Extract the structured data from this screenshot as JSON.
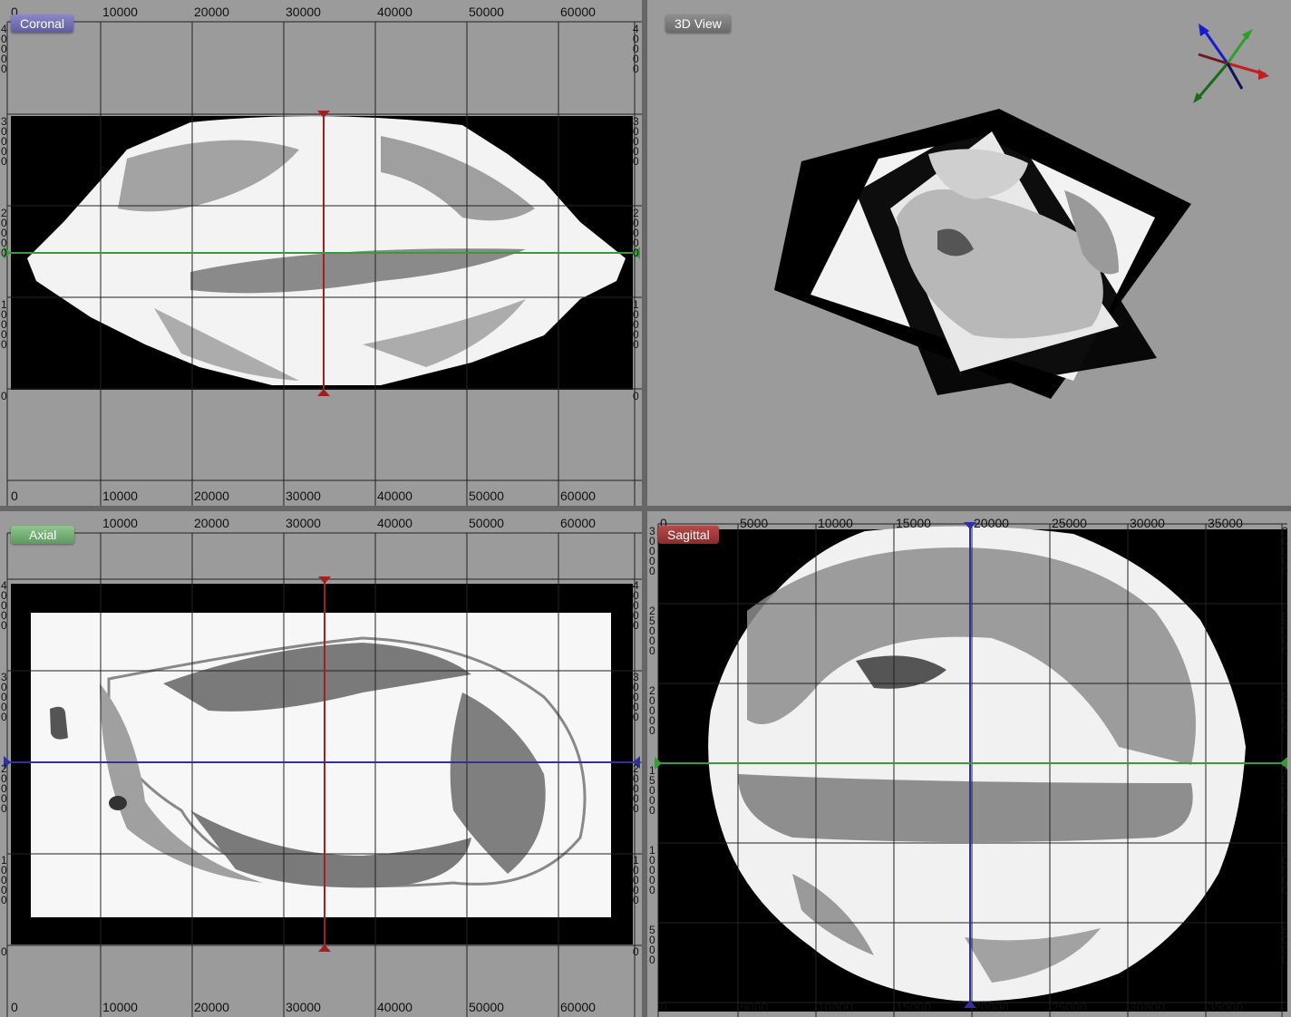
{
  "views": {
    "coronal": {
      "label": "Coronal"
    },
    "view3d": {
      "label": "3D View"
    },
    "axial": {
      "label": "Axial"
    },
    "sagittal": {
      "label": "Sagittal"
    }
  },
  "coronal_axis": {
    "x_ticks": [
      "0",
      "10000",
      "20000",
      "30000",
      "40000",
      "50000",
      "60000"
    ],
    "y_ticks_top_to_bottom": [
      "40000",
      "30000",
      "20000",
      "10000",
      "0"
    ],
    "corner_top_right": "4",
    "corner_bottom": "1"
  },
  "axial_axis": {
    "x_ticks": [
      "0",
      "10000",
      "20000",
      "30000",
      "40000",
      "50000",
      "60000"
    ],
    "y_ticks_top_to_bottom": [
      "40000",
      "30000",
      "20000",
      "10000",
      "0"
    ]
  },
  "sagittal_axis": {
    "x_ticks": [
      "0",
      "5000",
      "10000",
      "15000",
      "20000",
      "25000",
      "30000",
      "35000"
    ],
    "y_ticks_top_to_bottom": [
      "30000",
      "25000",
      "20000",
      "15000",
      "10000",
      "5000",
      "0"
    ]
  },
  "colors": {
    "panel_bg": "#9b9b9b",
    "crosshair_red": "#a02020",
    "crosshair_green": "#3a9a3a",
    "crosshair_blue": "#3030a0"
  }
}
